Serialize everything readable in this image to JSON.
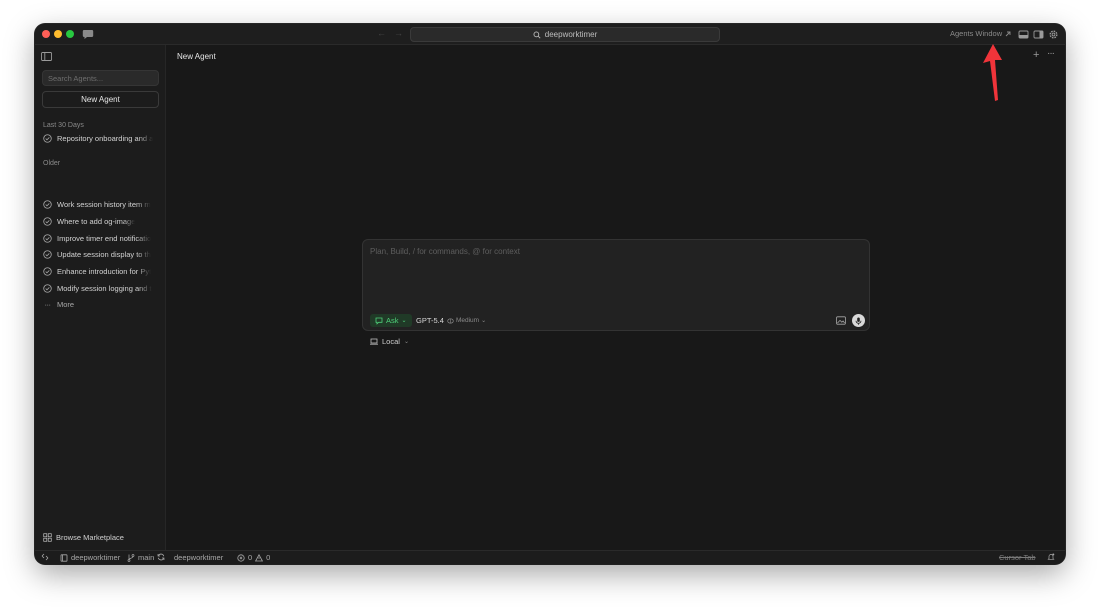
{
  "titlebar": {
    "search_text": "deepworktimer",
    "agents_window_label": "Agents Window",
    "agents_window_icon": "arrow-up-right-icon"
  },
  "sidebar": {
    "search_placeholder": "Search Agents...",
    "new_agent_label": "New Agent",
    "sections": [
      {
        "label": "Last 30 Days",
        "items": [
          {
            "label": "Repository onboarding and a"
          }
        ]
      },
      {
        "label": "Older",
        "items": [
          {
            "label": "Work session history item m"
          },
          {
            "label": "Where to add og-image"
          },
          {
            "label": "Improve timer end notificatio"
          },
          {
            "label": "Update session display to th"
          },
          {
            "label": "Enhance introduction for Pyt"
          },
          {
            "label": "Modify session logging and t"
          }
        ]
      }
    ],
    "more_label": "More",
    "browse_marketplace_label": "Browse Marketplace"
  },
  "main": {
    "title": "New Agent",
    "composer": {
      "placeholder": "Plan, Build, / for commands, @ for context",
      "mode_label": "Ask",
      "model_label": "GPT-5.4",
      "effort_label": "Medium"
    },
    "environment_label": "Local"
  },
  "statusbar": {
    "repo": "deepworktimer",
    "branch": "main",
    "folder": "deepworktimer",
    "errors": "0",
    "warnings": "0",
    "cursor_tab": "Cursor Tab"
  },
  "colors": {
    "window_bg": "#181818",
    "sidebar_bg": "#1c1c1c",
    "ask_accent": "#4fd07a",
    "annotation_arrow": "#f0343a"
  }
}
